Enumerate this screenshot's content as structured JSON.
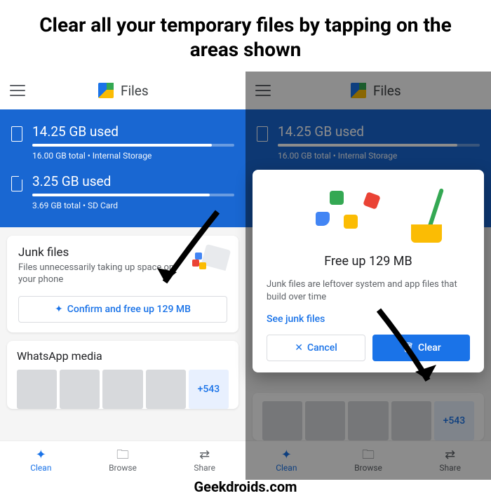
{
  "headline": "Clear all your temporary files by tapping on the areas shown",
  "app_name": "Files",
  "storage": {
    "internal": {
      "used": "14.25 GB used",
      "sub": "16.00 GB total • Internal Storage",
      "pct": 89
    },
    "sd": {
      "used": "3.25 GB used",
      "sub": "3.69 GB total • SD Card",
      "pct": 88
    }
  },
  "junk_card": {
    "title": "Junk files",
    "sub": "Files unnecessarily taking up space on your phone",
    "button": "Confirm and free up 129 MB"
  },
  "whatsapp": {
    "title": "WhatsApp media",
    "more": "+543"
  },
  "nav": {
    "clean": "Clean",
    "browse": "Browse",
    "share": "Share"
  },
  "dialog": {
    "title": "Free up 129 MB",
    "text": "Junk files are leftover system and app files that build over time",
    "see": "See junk files",
    "cancel": "Cancel",
    "clear": "Clear"
  },
  "watermark": "Geekdroids.com"
}
